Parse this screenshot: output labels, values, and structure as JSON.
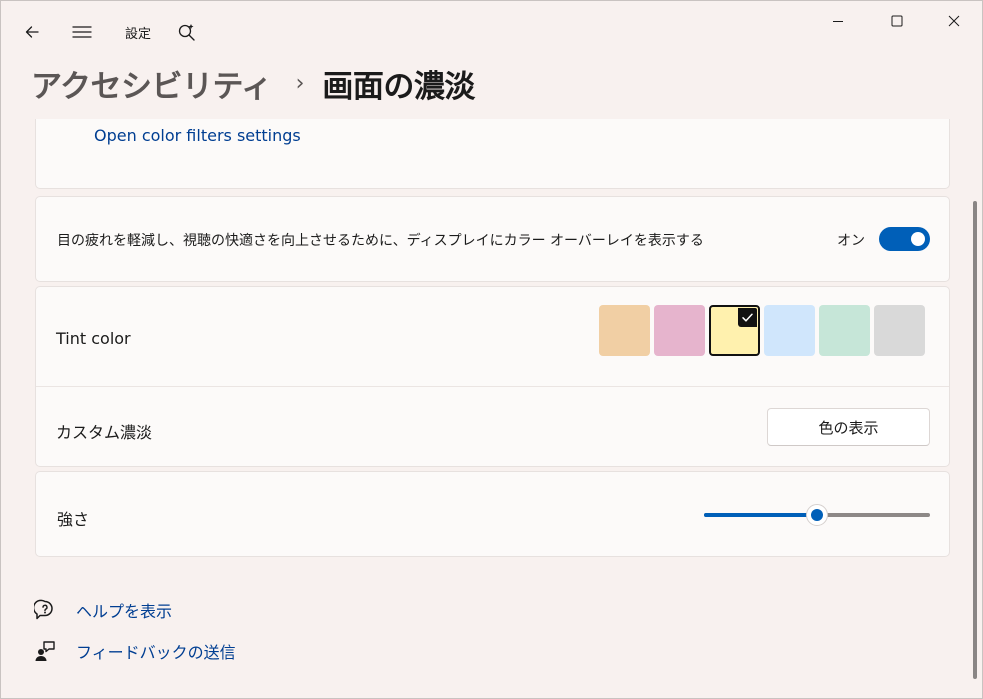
{
  "titlebar": {
    "title": "設定",
    "icons": [
      "back-arrow-icon",
      "hamburger-menu-icon",
      "search-sparkle-icon"
    ],
    "window_controls": [
      "minimize-icon",
      "maximize-icon",
      "close-icon"
    ]
  },
  "header": {
    "breadcrumb_parent": "アクセシビリティ",
    "breadcrumb_separator": "›",
    "breadcrumb_current": "画面の濃淡"
  },
  "filters_card": {
    "link": "Open color filters settings"
  },
  "overlay_card": {
    "description": "目の疲れを軽減し、視聴の快適さを向上させるために、ディスプレイにカラー オーバーレイを表示する",
    "toggle_state_label": "オン",
    "toggle_on": true
  },
  "tint_card": {
    "tint_label": "Tint color",
    "swatches": [
      {
        "name": "peach",
        "color": "#f1cfa4",
        "selected": false
      },
      {
        "name": "pink",
        "color": "#e6b4cd",
        "selected": false
      },
      {
        "name": "yellow",
        "color": "#fff1ae",
        "selected": true
      },
      {
        "name": "blue",
        "color": "#d0e6fc",
        "selected": false
      },
      {
        "name": "green",
        "color": "#c6e6d8",
        "selected": false
      },
      {
        "name": "gray",
        "color": "#d9d9d9",
        "selected": false
      }
    ],
    "custom_label": "カスタム濃淡",
    "show_colors_button": "色の表示"
  },
  "strength_card": {
    "label": "強さ",
    "slider_value": 0.5
  },
  "help_links": [
    {
      "icon": "help-chat-icon",
      "label": "ヘルプを表示"
    },
    {
      "icon": "feedback-icon",
      "label": "フィードバックの送信"
    }
  ],
  "colors": {
    "accent": "#005fb8",
    "link": "#003e92"
  }
}
